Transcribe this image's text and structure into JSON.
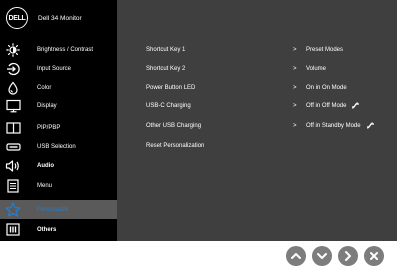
{
  "header": {
    "logo_text": "DELL",
    "model": "Dell 34 Monitor"
  },
  "sidebar": {
    "items": [
      {
        "label": "Brightness / Contrast",
        "icon": "brightness-icon"
      },
      {
        "label": "Input Source",
        "icon": "input-source-icon"
      },
      {
        "label": "Color",
        "icon": "color-icon"
      },
      {
        "label": "Display",
        "icon": "display-icon"
      },
      {
        "label": "PIP/PBP",
        "icon": "pip-pbp-icon"
      },
      {
        "label": "USB Selection",
        "icon": "usb-selection-icon"
      },
      {
        "label": "Audio",
        "icon": "audio-icon"
      },
      {
        "label": "Menu",
        "icon": "menu-icon"
      },
      {
        "label": "Personalize",
        "icon": "star-icon",
        "active": true
      },
      {
        "label": "Others",
        "icon": "others-icon"
      }
    ]
  },
  "personalize": {
    "rows": [
      {
        "label": "Shortcut Key 1",
        "value": "Preset Modes"
      },
      {
        "label": "Shortcut Key 2",
        "value": "Volume"
      },
      {
        "label": "Power Button LED",
        "value": "On in On Mode"
      },
      {
        "label": "USB-C Charging",
        "value": "Off in Off Mode",
        "value_icon": "charging-icon"
      },
      {
        "label": "Other USB Charging",
        "value": "Off in Standby Mode",
        "value_icon": "charging-icon"
      },
      {
        "label": "Reset Personalization",
        "value": ""
      }
    ],
    "chevron": ">"
  },
  "colors": {
    "accent": "#1f7fd6",
    "sidebar_bg": "#000000",
    "panel_bg": "#3f3f3f",
    "button_bg": "#7d7d7d"
  },
  "nav_buttons": [
    "up-button",
    "down-button",
    "right-button",
    "close-button"
  ]
}
